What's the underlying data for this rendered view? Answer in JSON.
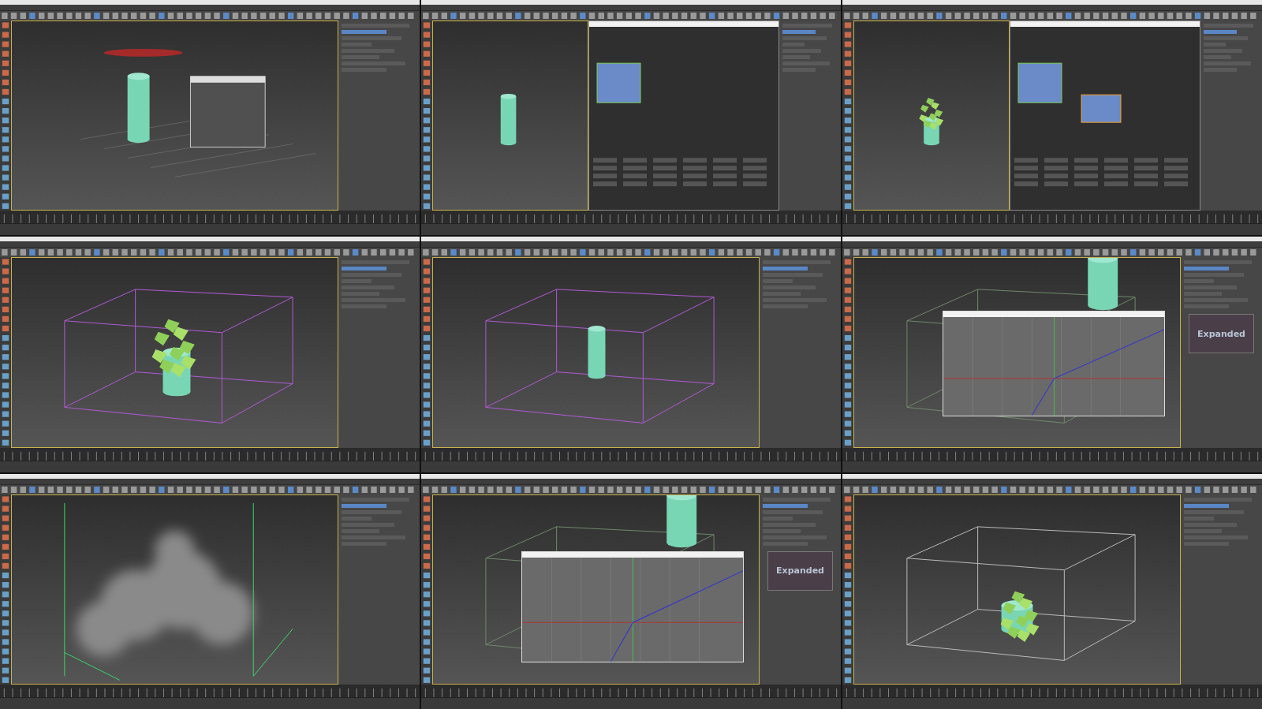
{
  "panels": [
    {
      "kind": "cylinder-dialog"
    },
    {
      "kind": "cylinder-nodes"
    },
    {
      "kind": "fracture-nodes"
    },
    {
      "kind": "fracture-box"
    },
    {
      "kind": "cylinder-box"
    },
    {
      "kind": "curve-tall",
      "expanded_label": "Expanded"
    },
    {
      "kind": "smoke"
    },
    {
      "kind": "curve-wide",
      "expanded_label": "Expanded"
    },
    {
      "kind": "debris"
    }
  ]
}
